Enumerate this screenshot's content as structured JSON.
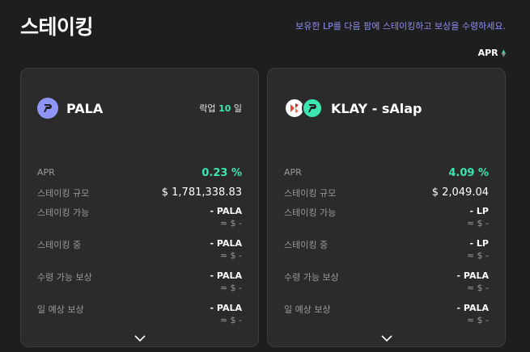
{
  "header": {
    "title": "스테이킹",
    "hint": "보유한 LP를 다음 팜에 스테이킹하고 보상을 수령하세요.",
    "sort_label": "APR"
  },
  "labels": {
    "apr": "APR",
    "tvl": "스테이킹 규모",
    "available": "스테이킹 가능",
    "staked": "스테이킹 중",
    "claimable": "수령 가능 보상",
    "daily": "일 예상 보상"
  },
  "cards": [
    {
      "name": "PALA",
      "lockup_prefix": "락업",
      "lockup_days": "10",
      "lockup_suffix": "일",
      "apr": "0.23 %",
      "tvl": "$ 1,781,338.83",
      "available": "- PALA",
      "available_usd": "≈ $ -",
      "staked": "- PALA",
      "staked_usd": "≈ $ -",
      "claimable": "- PALA",
      "claimable_usd": "≈ $ -",
      "daily": "- PALA",
      "daily_usd": "≈ $ -",
      "icons": [
        "pala-icon"
      ]
    },
    {
      "name": "KLAY - sAlap",
      "apr": "4.09 %",
      "tvl": "$ 2,049.04",
      "available": "- LP",
      "available_usd": "≈ $ -",
      "staked": "- LP",
      "staked_usd": "≈ $ -",
      "claimable": "- PALA",
      "claimable_usd": "≈ $ -",
      "daily": "- PALA",
      "daily_usd": "≈ $ -",
      "icons": [
        "klay-icon",
        "salap-icon"
      ]
    }
  ],
  "colors": {
    "accent_green": "#3ce6b3",
    "hint_purple": "#8d8ff5",
    "pala_purple": "#8f95f6",
    "klay_red": "#e8452f"
  }
}
